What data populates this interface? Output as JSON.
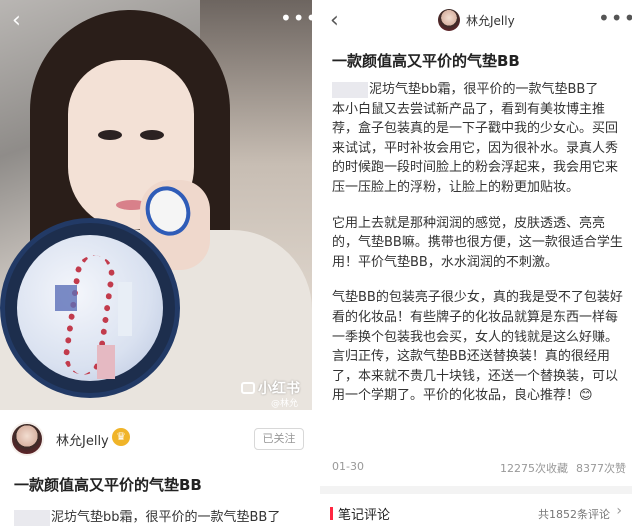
{
  "left": {
    "watermark": "小红书",
    "watermark_sub": "@林允",
    "author": {
      "name": "林允Jelly",
      "follow_label": "已关注"
    },
    "title": "一款颜值高又平价的气垫BB",
    "snippet": "泥坊气垫bb霜，很平价的一款气垫BB了"
  },
  "right": {
    "header": {
      "name": "林允Jelly"
    },
    "title": "一款颜值高又平价的气垫BB",
    "paragraphs": [
      "泥坊气垫bb霜，很平价的一款气垫BB了",
      "本小白鼠又去尝试新产品了，看到有美妆博主推荐，盒子包装真的是一下子戳中我的少女心。买回来试试，平时补妆会用它，因为很补水。录真人秀的时候跑一段时间脸上的粉会浮起来，我会用它来压一压脸上的浮粉，让脸上的粉更加贴妆。",
      "它用上去就是那种润润的感觉，皮肤透透、亮亮的，气垫BB嘛。携带也很方便，这一款很适合学生用！平价气垫BB，水水润润的不刺激。",
      "气垫BB的包装亮子很少女，真的我是受不了包装好看的化妆品！有些牌子的化妆品就算是东西一样每一季换个包装我也会买，女人的钱就是这么好赚。言归正传，这款气垫BB还送替换装！真的很经用了，本来就不贵几十块钱，还送一个替换装，可以用一个学期了。平价的化妆品，良心推荐！😊"
    ],
    "stats": {
      "date": "01-30",
      "views": "12275次收藏",
      "shares": "8377次赞"
    },
    "comments": {
      "label": "笔记评论",
      "count": "共1852条评论"
    }
  },
  "icons": {
    "back": "chevron-left",
    "more": "ellipsis",
    "crown": "crown",
    "camera": "camera"
  },
  "colors": {
    "accent": "#ff2741",
    "badge": "#f0b429"
  }
}
